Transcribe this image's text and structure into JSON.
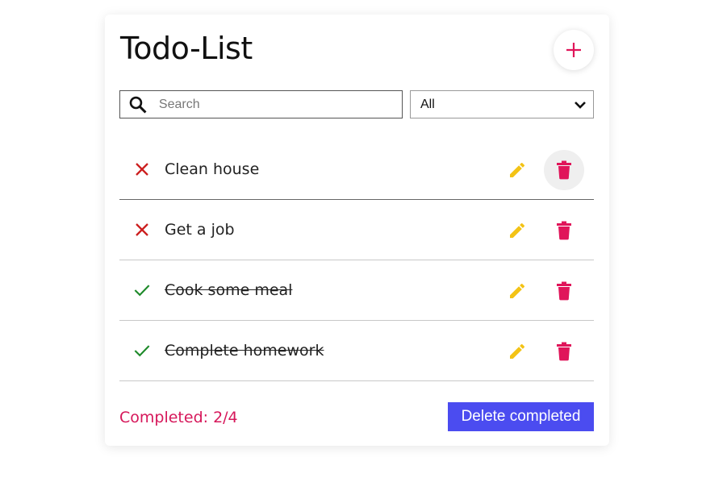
{
  "app": {
    "title": "Todo-List"
  },
  "search": {
    "placeholder": "Search",
    "value": ""
  },
  "filter": {
    "selected": "All"
  },
  "todos": [
    {
      "text": "Clean house",
      "completed": false
    },
    {
      "text": "Get a job",
      "completed": false
    },
    {
      "text": "Cook some meal",
      "completed": true
    },
    {
      "text": "Complete homework",
      "completed": true
    }
  ],
  "footer": {
    "completed_label": "Completed: 2/4",
    "delete_completed_label": "Delete completed"
  },
  "colors": {
    "accent_pink": "#e0155a",
    "edit_yellow": "#f3c316",
    "incomplete_red": "#cc1f1f",
    "complete_green": "#1e8a2a",
    "primary_button": "#4b4cf0"
  },
  "icons": {
    "add": "plus-icon",
    "search": "search-icon",
    "filter": "chevron-down-icon",
    "incomplete": "x-icon",
    "complete": "check-icon",
    "edit": "pencil-icon",
    "delete": "trash-icon"
  }
}
